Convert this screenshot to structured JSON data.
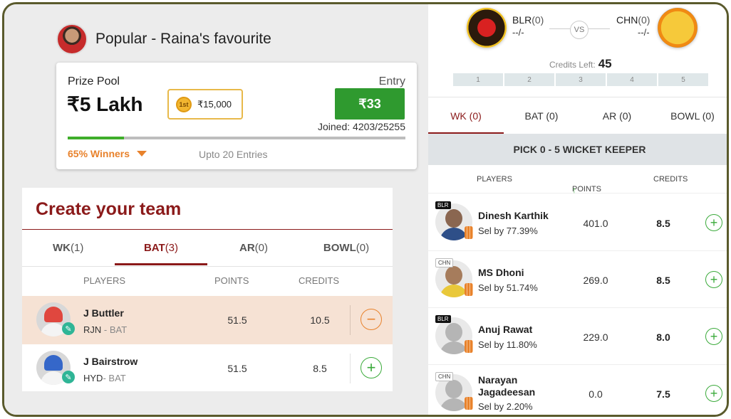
{
  "contest": {
    "title": "Popular - Raina's favourite",
    "prize_label": "Prize Pool",
    "prize_amount": "₹5 Lakh",
    "first_prize_rank": "1st",
    "first_prize_amount": "₹15,000",
    "entry_label": "Entry",
    "entry_fee": "₹33",
    "joined": "Joined: 4203/25255",
    "joined_fraction": 0.166,
    "winners": "65% Winners",
    "entries_limit": "Upto 20 Entries"
  },
  "team": {
    "title": "Create your team",
    "tabs": [
      {
        "name": "WK",
        "count": "(1)"
      },
      {
        "name": "BAT",
        "count": "(3)",
        "active": true
      },
      {
        "name": "AR",
        "count": "(0)"
      },
      {
        "name": "BOWL",
        "count": "(0)"
      }
    ],
    "headers": {
      "players": "PLAYERS",
      "points": "POINTS",
      "credits": "CREDITS"
    },
    "players": [
      {
        "name": "J Buttler",
        "team": "RJN",
        "role": "- BAT",
        "points": "51.5",
        "credits": "10.5",
        "selected": true
      },
      {
        "name": "J Bairstrow",
        "team": "HYD",
        "role": "- BAT",
        "points": "51.5",
        "credits": "8.5",
        "selected": false
      }
    ]
  },
  "match": {
    "home": {
      "name": "BLR",
      "score": "(0)",
      "sub": "--/-"
    },
    "away": {
      "name": "CHN",
      "score": "(0)",
      "sub": "--/-"
    },
    "vs": "VS",
    "credits_left_label": "Credits Left:",
    "credits_left": "45",
    "count_cells": [
      "1",
      "2",
      "3",
      "4",
      "5"
    ]
  },
  "roles": {
    "tabs": [
      "WK (0)",
      "BAT (0)",
      "AR (0)",
      "BOWL (0)"
    ],
    "active": 0,
    "banner": "PICK 0 - 5 WICKET KEEPER",
    "headers": {
      "players": "PLAYERS",
      "points": "POINTS",
      "credits": "CREDITS"
    },
    "players": [
      {
        "tag": "BLR",
        "name": "Dinesh Karthik",
        "sel": "Sel by 77.39%",
        "points": "401.0",
        "credits": "8.5"
      },
      {
        "tag": "CHN",
        "name": "MS Dhoni",
        "sel": "Sel by 51.74%",
        "points": "269.0",
        "credits": "8.5"
      },
      {
        "tag": "BLR",
        "name": "Anuj Rawat",
        "sel": "Sel by 11.80%",
        "points": "229.0",
        "credits": "8.0"
      },
      {
        "tag": "CHN",
        "name_line1": "Narayan",
        "name_line2": "Jagadeesan",
        "sel": "Sel by 2.20%",
        "points": "0.0",
        "credits": "7.5"
      }
    ]
  },
  "colors": {
    "accent": "#8b1a1a",
    "entry_green": "#2f9a2f",
    "winners_orange": "#e8822c",
    "add_green": "#3aaa3a"
  }
}
